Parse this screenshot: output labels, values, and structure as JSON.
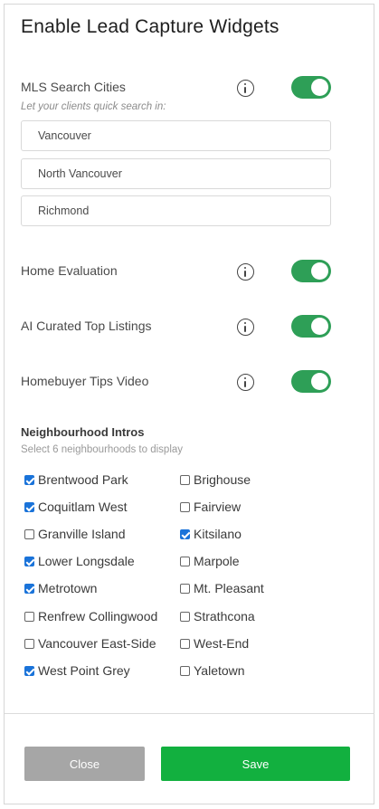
{
  "dialog": {
    "title": "Enable Lead Capture Widgets"
  },
  "mls": {
    "label": "MLS Search Cities",
    "hint": "Let your clients quick search in:",
    "enabled": true,
    "cities": [
      "Vancouver",
      "North Vancouver",
      "Richmond"
    ]
  },
  "widgets": [
    {
      "label": "Home Evaluation",
      "enabled": true
    },
    {
      "label": "AI Curated Top Listings",
      "enabled": true
    },
    {
      "label": "Homebuyer Tips Video",
      "enabled": true
    }
  ],
  "neighbourhoods": {
    "title": "Neighbourhood Intros",
    "hint": "Select 6 neighbourhoods to display",
    "items": [
      {
        "name": "Brentwood Park",
        "checked": true
      },
      {
        "name": "Brighouse",
        "checked": false
      },
      {
        "name": "Coquitlam West",
        "checked": true
      },
      {
        "name": "Fairview",
        "checked": false
      },
      {
        "name": "Granville Island",
        "checked": false
      },
      {
        "name": "Kitsilano",
        "checked": true
      },
      {
        "name": "Lower Longsdale",
        "checked": true
      },
      {
        "name": "Marpole",
        "checked": false
      },
      {
        "name": "Metrotown",
        "checked": true
      },
      {
        "name": "Mt. Pleasant",
        "checked": false
      },
      {
        "name": "Renfrew Collingwood",
        "checked": false
      },
      {
        "name": "Strathcona",
        "checked": false
      },
      {
        "name": "Vancouver East-Side",
        "checked": false
      },
      {
        "name": "West-End",
        "checked": false
      },
      {
        "name": "West Point Grey",
        "checked": true
      },
      {
        "name": "Yaletown",
        "checked": false
      }
    ]
  },
  "footer": {
    "close_label": "Close",
    "save_label": "Save"
  },
  "colors": {
    "toggle_on": "#2e9f57",
    "save": "#12b03f",
    "close": "#a6a6a6",
    "checkbox": "#1a73d9"
  },
  "icons": {
    "info": "info-circle-icon"
  }
}
